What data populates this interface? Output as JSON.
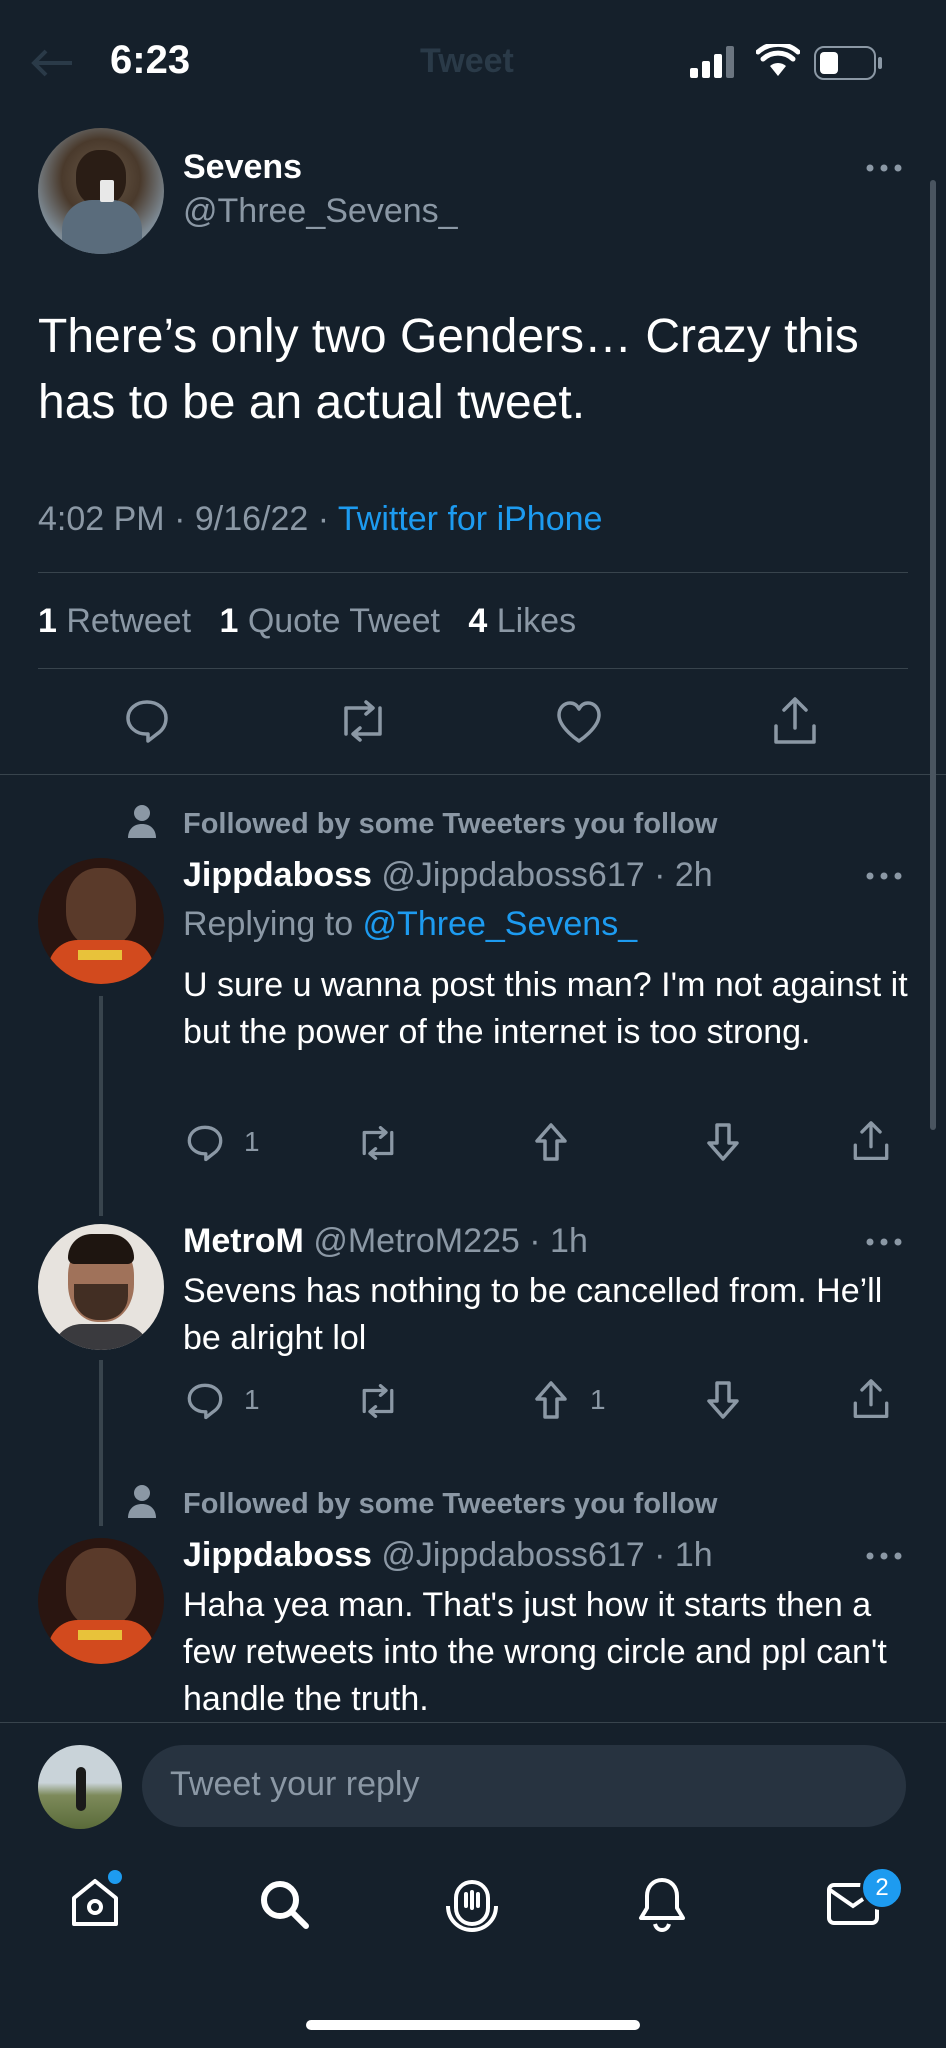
{
  "status_bar": {
    "time": "6:23"
  },
  "header": {
    "title": "Tweet"
  },
  "tweet": {
    "display_name": "Sevens",
    "handle": "@Three_Sevens_",
    "text": "There’s only two Genders… Crazy this has to be an actual tweet.",
    "time": "4:02 PM · 9/16/22 · ",
    "source": "Twitter for iPhone",
    "stats": {
      "retweets_count": "1",
      "retweets_label": "Retweet",
      "quotes_count": "1",
      "quotes_label": "Quote Tweet",
      "likes_count": "4",
      "likes_label": "Likes"
    }
  },
  "replies": [
    {
      "social_context": "Followed by some Tweeters you follow",
      "display_name": "Jippdaboss",
      "handle": "@Jippdaboss617 · 2h",
      "replying_to_prefix": "Replying to ",
      "replying_to_handle": "@Three_Sevens_",
      "text": "U sure u wanna post this man? I'm not against it but the power of the internet is too strong.",
      "reply_count": "1",
      "upvote_count": ""
    },
    {
      "display_name": "MetroM",
      "handle": "@MetroM225 · 1h",
      "text": "Sevens has nothing to be cancelled from. He’ll be alright lol",
      "reply_count": "1",
      "upvote_count": "1"
    },
    {
      "social_context": "Followed by some Tweeters you follow",
      "display_name": "Jippdaboss",
      "handle": "@Jippdaboss617 · 1h",
      "text": "Haha yea man. That's just how it starts then a few retweets into the wrong circle and ppl can't handle the truth."
    }
  ],
  "composer": {
    "placeholder": "Tweet your reply"
  },
  "tab_bar": {
    "messages_badge": "2"
  },
  "colors": {
    "background": "#15202b",
    "accent": "#1d9bf0",
    "muted": "#8b98a5",
    "divider": "#38444d"
  }
}
